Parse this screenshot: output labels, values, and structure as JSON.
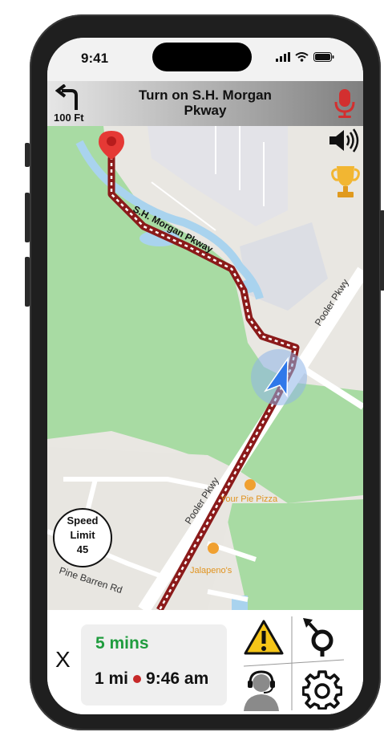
{
  "status_bar": {
    "time": "9:41"
  },
  "navigation": {
    "distance": "100 Ft",
    "instruction": "Turn on S.H. Morgan Pkway"
  },
  "map": {
    "road_labels": [
      "S.H. Morgan Pkway",
      "Pooler Pkwy",
      "Pooler Pkwy",
      "Pine Barren Rd"
    ],
    "places": [
      "Your Pie Pizza",
      "Jalapeno's"
    ]
  },
  "speed_limit": {
    "line1": "Speed",
    "line2": "Limit",
    "value": "45"
  },
  "trip": {
    "close_label": "X",
    "duration": "5 mins",
    "distance": "1 mi",
    "arrival": "9:46 am"
  },
  "icons": {
    "turn": "turn-left-icon",
    "mic": "microphone-icon",
    "sound": "speaker-icon",
    "trophy": "trophy-icon",
    "hazard": "warning-icon",
    "reroute": "reroute-icon",
    "support": "support-agent-icon",
    "settings": "gear-icon"
  },
  "colors": {
    "route": "#8b1a1a",
    "eta_green": "#1f9c3e",
    "map_green": "#a8dba3",
    "water": "#a9d3ee"
  }
}
